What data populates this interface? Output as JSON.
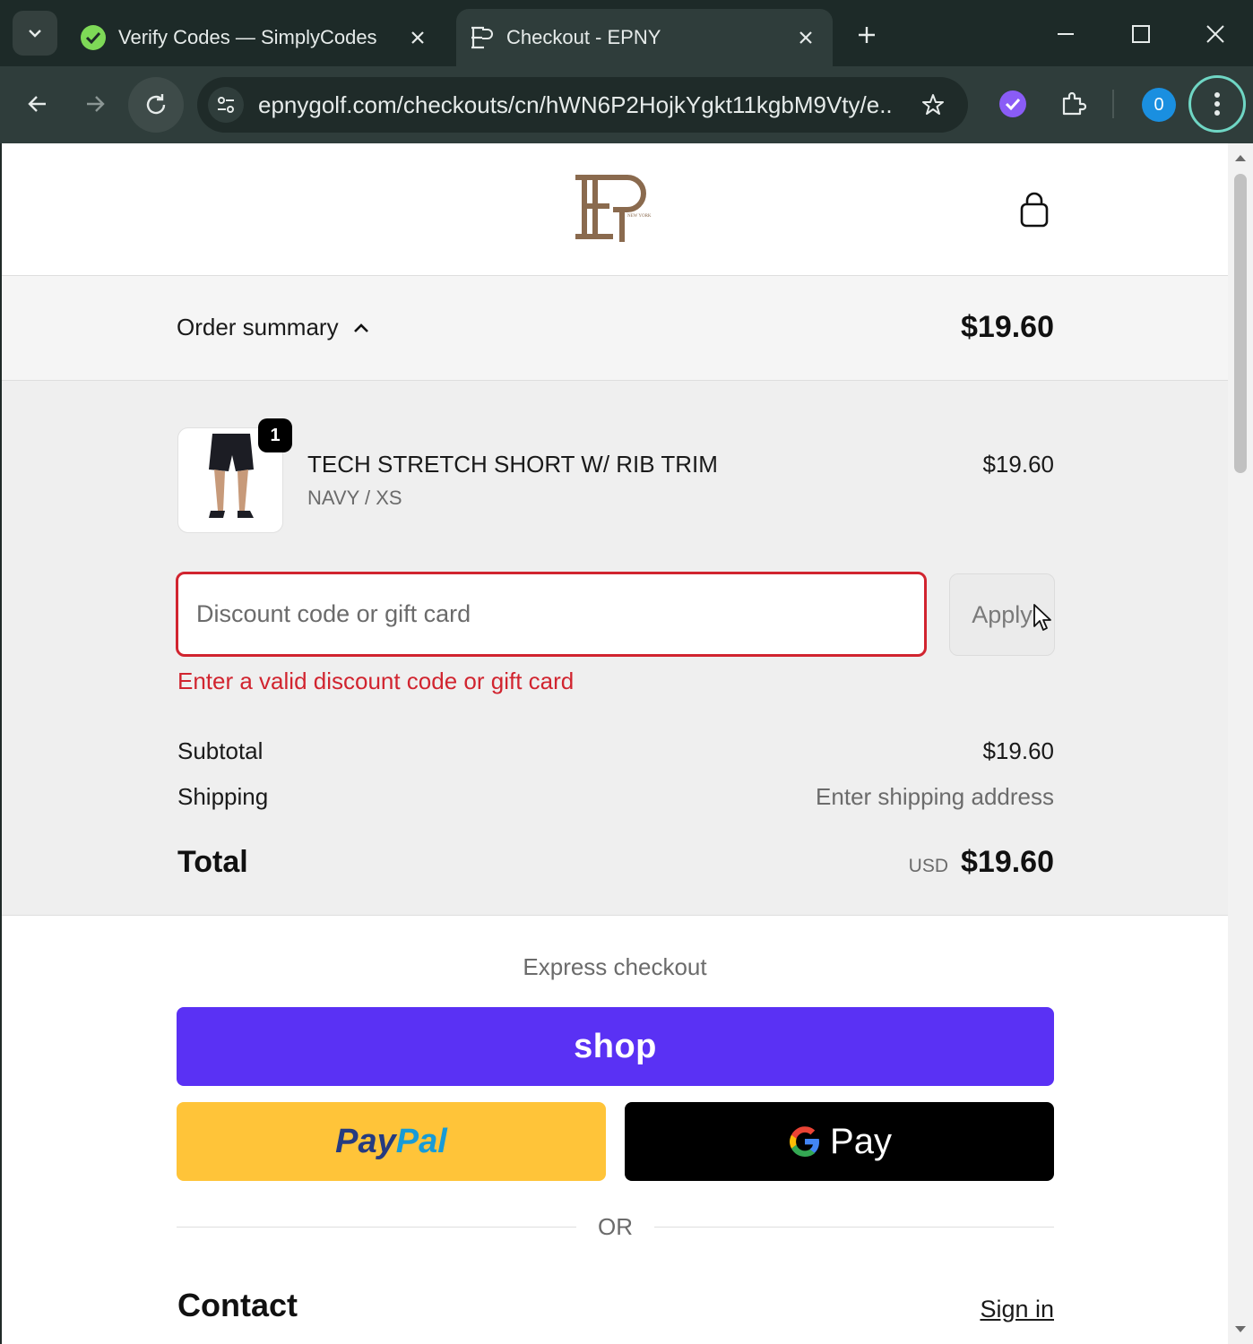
{
  "browser": {
    "tabs": [
      {
        "title": "Verify Codes — SimplyCodes",
        "active": false,
        "favicon": "simplycodes-icon"
      },
      {
        "title": "Checkout - EPNY",
        "active": true,
        "favicon": "epny-icon"
      }
    ],
    "url": "epnygolf.com/checkouts/cn/hWN6P2HojkYgkt11kgbM9Vty/e...",
    "profile_initial": "0"
  },
  "header": {
    "logo": "epny-logo",
    "cart_icon": "shopping-bag-icon"
  },
  "order_summary": {
    "toggle_label": "Order summary",
    "total": "$19.60"
  },
  "line_items": [
    {
      "quantity": "1",
      "name": "TECH STRETCH SHORT W/ RIB TRIM",
      "variant": "NAVY / XS",
      "price": "$19.60"
    }
  ],
  "discount": {
    "placeholder": "Discount code or gift card",
    "value": "",
    "apply_label": "Apply",
    "error": "Enter a valid discount code or gift card"
  },
  "totals": {
    "subtotal_label": "Subtotal",
    "subtotal_value": "$19.60",
    "shipping_label": "Shipping",
    "shipping_value": "Enter shipping address",
    "total_label": "Total",
    "currency": "USD",
    "total_value": "$19.60"
  },
  "express_checkout": {
    "label": "Express checkout",
    "shop_label": "shop",
    "paypal_part1": "Pay",
    "paypal_part2": "Pal",
    "gpay_label": "Pay",
    "or_label": "OR"
  },
  "contact": {
    "heading": "Contact",
    "signin_label": "Sign in"
  },
  "colors": {
    "error": "#d1242f",
    "shop_purple": "#5a31f4",
    "paypal_yellow": "#ffc439",
    "brand_brown": "#8a6a4e"
  }
}
